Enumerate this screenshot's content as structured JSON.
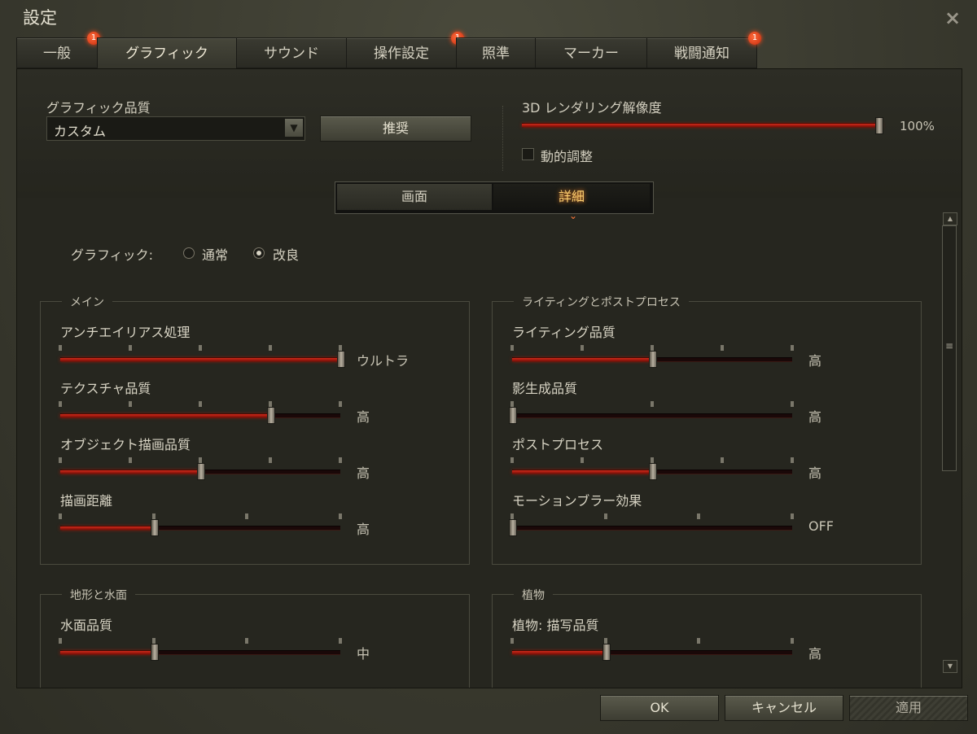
{
  "window": {
    "title": "設定",
    "close_icon": "×"
  },
  "tabs": [
    {
      "label": "一般",
      "badge": "1"
    },
    {
      "label": "グラフィック",
      "badge": ""
    },
    {
      "label": "サウンド",
      "badge": ""
    },
    {
      "label": "操作設定",
      "badge": "1"
    },
    {
      "label": "照準",
      "badge": ""
    },
    {
      "label": "マーカー",
      "badge": ""
    },
    {
      "label": "戦闘通知",
      "badge": "1"
    }
  ],
  "active_tab": "グラフィック",
  "top": {
    "quality_label": "グラフィック品質",
    "quality_value": "カスタム",
    "recommend_button": "推奨",
    "resolution_label": "3D レンダリング解像度",
    "resolution_value": "100%",
    "resolution_level": 1.0,
    "dynamic_label": "動的調整",
    "dynamic_checked": false
  },
  "subtabs": {
    "screen": "画面",
    "detail": "詳細",
    "active": "詳細"
  },
  "graphics_mode": {
    "label": "グラフィック:",
    "normal": "通常",
    "improved": "改良",
    "selected": "改良"
  },
  "groups": {
    "main": {
      "title": "メイン",
      "settings": [
        {
          "label": "アンチエイリアス処理",
          "value": "ウルトラ",
          "ticks": 5,
          "position": 4
        },
        {
          "label": "テクスチャ品質",
          "value": "高",
          "ticks": 5,
          "position": 3
        },
        {
          "label": "オブジェクト描画品質",
          "value": "高",
          "ticks": 5,
          "position": 2
        },
        {
          "label": "描画距離",
          "value": "高",
          "ticks": 4,
          "position": 1
        }
      ]
    },
    "lighting": {
      "title": "ライティングとポストプロセス",
      "settings": [
        {
          "label": "ライティング品質",
          "value": "高",
          "ticks": 5,
          "position": 2
        },
        {
          "label": "影生成品質",
          "value": "高",
          "ticks": 3,
          "position": 0
        },
        {
          "label": "ポストプロセス",
          "value": "高",
          "ticks": 5,
          "position": 2
        },
        {
          "label": "モーションブラー効果",
          "value": "OFF",
          "ticks": 4,
          "position": 0
        }
      ]
    },
    "terrain": {
      "title": "地形と水面",
      "settings": [
        {
          "label": "水面品質",
          "value": "中",
          "ticks": 4,
          "position": 1
        }
      ]
    },
    "vegetation": {
      "title": "植物",
      "settings": [
        {
          "label": "植物: 描写品質",
          "value": "高",
          "ticks": 4,
          "position": 1
        }
      ]
    }
  },
  "buttons": {
    "ok": "OK",
    "cancel": "キャンセル",
    "apply": "適用"
  },
  "colors": {
    "accent_red": "#c8201a",
    "badge": "#e03a12",
    "active_text": "#ffd070"
  }
}
